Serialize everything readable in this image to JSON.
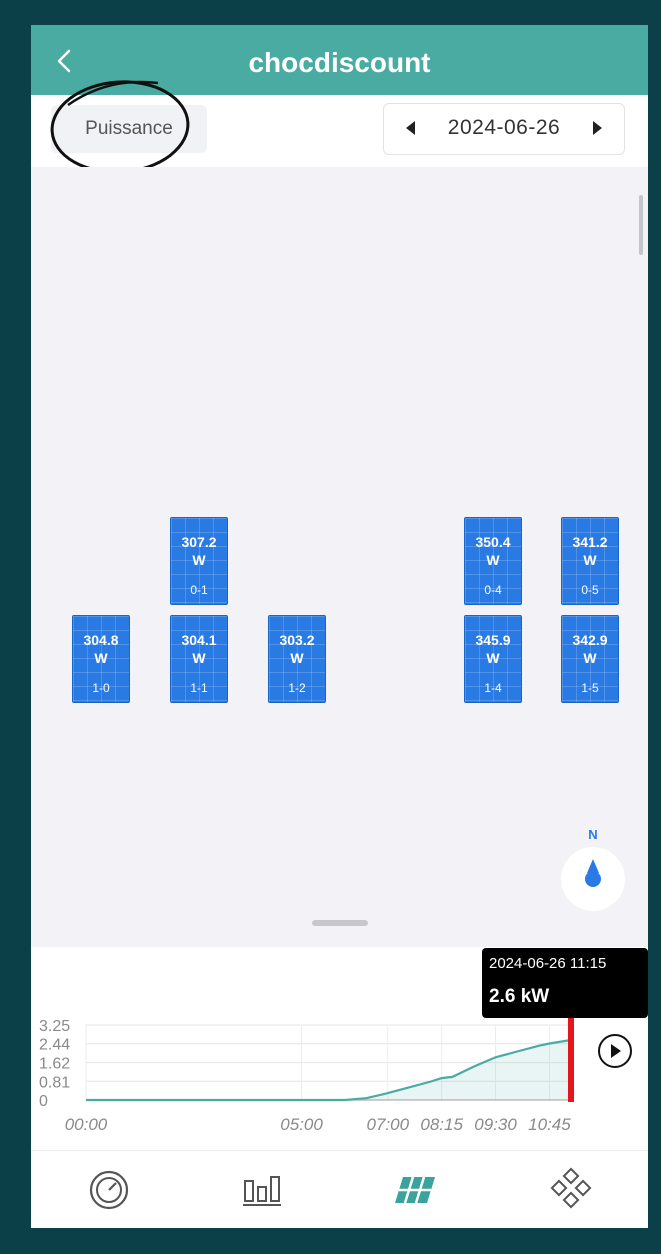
{
  "header": {
    "title": "chocdiscount",
    "back_icon": "chevron-left-icon"
  },
  "toolbar": {
    "mode_label": "Puissance",
    "date": "2024-06-26",
    "prev_icon": "caret-left-icon",
    "next_icon": "caret-right-icon"
  },
  "layout": {
    "panels": [
      {
        "value": "307.2",
        "unit": "W",
        "id": "0-1"
      },
      {
        "value": "350.4",
        "unit": "W",
        "id": "0-4"
      },
      {
        "value": "341.2",
        "unit": "W",
        "id": "0-5"
      },
      {
        "value": "304.8",
        "unit": "W",
        "id": "1-0"
      },
      {
        "value": "304.1",
        "unit": "W",
        "id": "1-1"
      },
      {
        "value": "303.2",
        "unit": "W",
        "id": "1-2"
      },
      {
        "value": "345.9",
        "unit": "W",
        "id": "1-4"
      },
      {
        "value": "342.9",
        "unit": "W",
        "id": "1-5"
      }
    ],
    "compass_label": "N",
    "panel_color": "#2a7ae4"
  },
  "tooltip": {
    "datetime": "2024-06-26 11:15",
    "value": "2.6 kW"
  },
  "chart_data": {
    "type": "area",
    "x": [
      "00:00",
      "05:00",
      "06:00",
      "06:30",
      "07:00",
      "07:30",
      "08:00",
      "08:15",
      "08:30",
      "09:00",
      "09:30",
      "10:00",
      "10:30",
      "10:45",
      "11:15"
    ],
    "y": [
      0,
      0,
      0,
      0.08,
      0.3,
      0.55,
      0.8,
      0.95,
      1.0,
      1.45,
      1.85,
      2.1,
      2.35,
      2.45,
      2.6
    ],
    "x_ticks": [
      "00:00",
      "05:00",
      "07:00",
      "08:15",
      "09:30",
      "10:45"
    ],
    "y_ticks": [
      "0",
      "0.81",
      "1.62",
      "2.44",
      "3.25"
    ],
    "ylim": [
      0,
      3.25
    ],
    "line_color": "#4aaba2",
    "marker_color": "#e3161b"
  },
  "tabs": [
    {
      "icon": "gauge-icon"
    },
    {
      "icon": "bar-chart-icon"
    },
    {
      "icon": "solar-panel-icon"
    },
    {
      "icon": "diamond-grid-icon"
    }
  ],
  "colors": {
    "header": "#4aaba2",
    "accent": "#2a7ae4"
  }
}
